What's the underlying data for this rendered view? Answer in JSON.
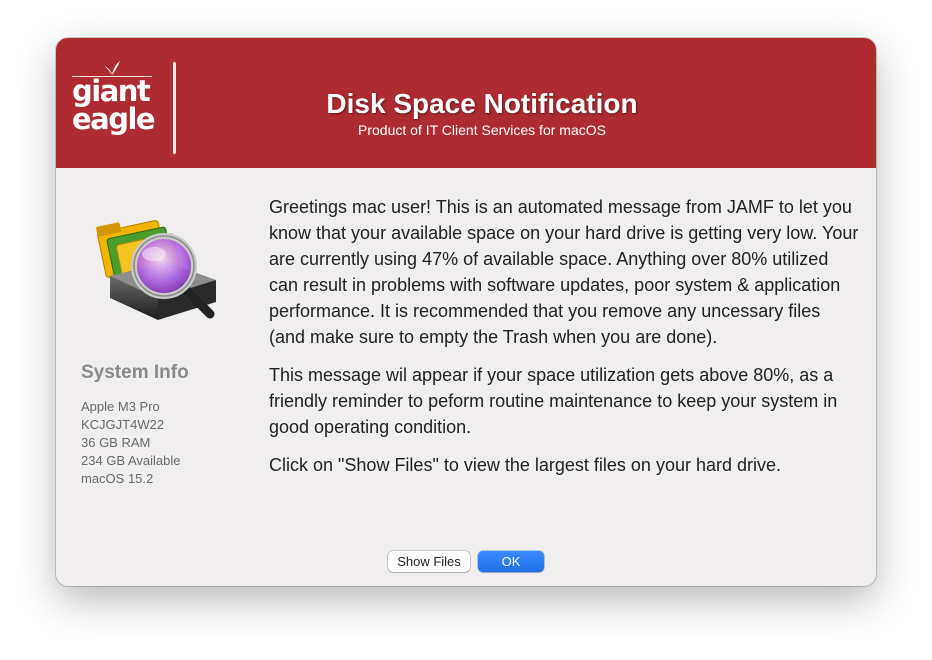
{
  "dialog": {
    "logo": {
      "line1": "giant",
      "line2": "eagle"
    },
    "title": "Disk Space Notification",
    "subtitle": "Product of IT Client Services for macOS",
    "icon": "disk-inspector-icon",
    "system_info": {
      "heading": "System Info",
      "items": [
        "Apple M3 Pro",
        "KCJGJT4W22",
        "36 GB RAM",
        "234 GB Available",
        "macOS 15.2"
      ]
    },
    "message": {
      "paragraphs": [
        "Greetings mac user!  This is an automated message from JAMF to let you know that your available space on your hard drive is getting very low. Your are currently using 47% of available space.  Anything over 80% utilized can result in problems with software updates, poor system & application performance.  It is recommended that you remove any uncessary files (and make sure to empty the Trash when you are done).",
        "This message wil appear if your space utilization gets above 80%, as a friendly reminder to peform routine maintenance to keep your system in good operating condition.",
        "Click on \"Show Files\" to view the largest files on your hard drive."
      ]
    },
    "buttons": {
      "show_files": "Show Files",
      "ok": "OK"
    },
    "colors": {
      "banner": "#ae2b30",
      "primary_button": "#1f6fe8",
      "background": "#f0eeee"
    }
  }
}
